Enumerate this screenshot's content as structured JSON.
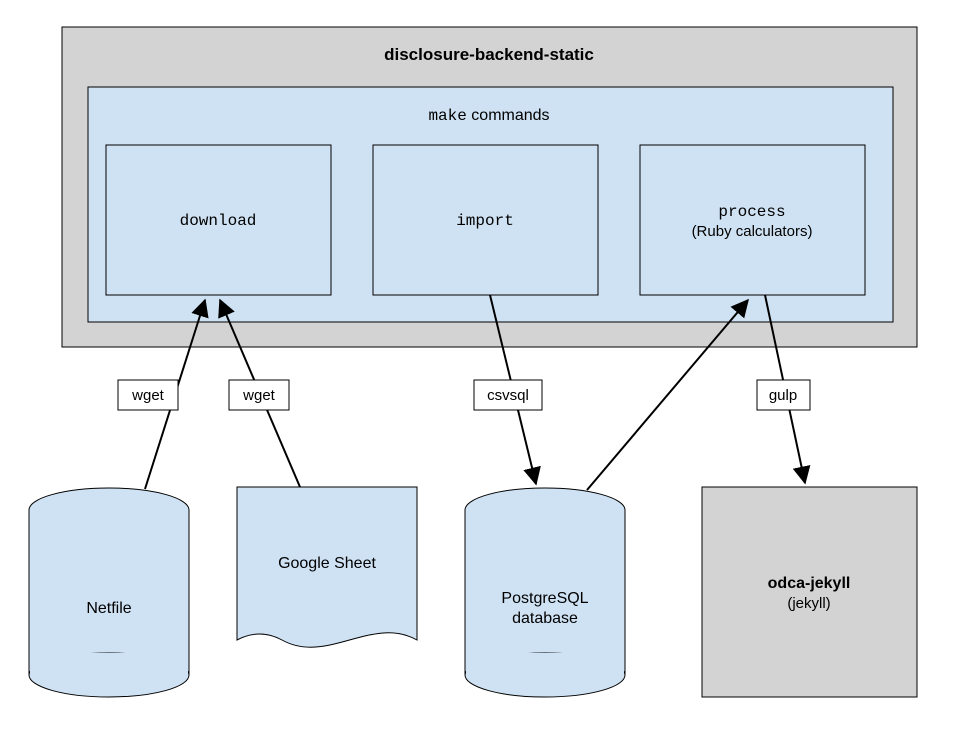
{
  "outer": {
    "title": "disclosure-backend-static"
  },
  "commands": {
    "title_prefix": "make",
    "title_suffix": " commands",
    "download": "download",
    "import": "import",
    "process_line1": "process",
    "process_line2": "(Ruby calculators)"
  },
  "edges": {
    "wget1": "wget",
    "wget2": "wget",
    "csvsql": "csvsql",
    "gulp": "gulp"
  },
  "nodes": {
    "netfile": "Netfile",
    "googlesheet": "Google Sheet",
    "postgres_line1": "PostgreSQL",
    "postgres_line2": "database",
    "jekyll_line1": "odca-jekyll",
    "jekyll_line2": "(jekyll)"
  }
}
